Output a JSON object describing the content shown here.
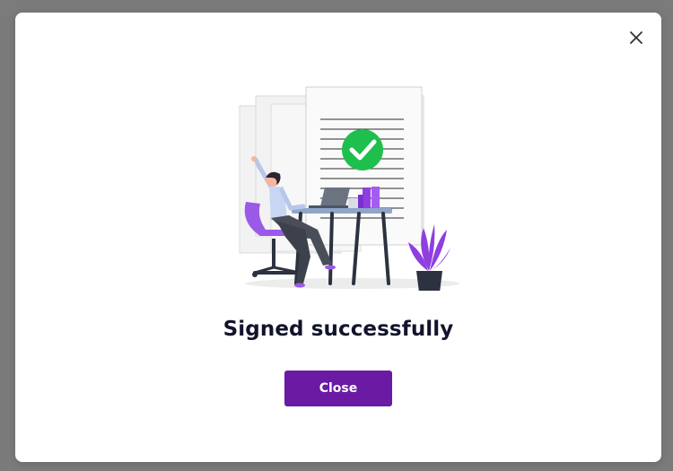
{
  "dialog": {
    "title": "Signed successfully",
    "close_button_label": "Close",
    "close_icon": "close-icon",
    "illustration": "woman-celebrating-at-desk-illustration"
  },
  "colors": {
    "backdrop": "#7b7b7b",
    "modal_bg": "#ffffff",
    "title_text": "#12142c",
    "primary_button_bg": "#6a1aa3",
    "primary_button_text": "#ffffff",
    "success_check": "#1fbf4e",
    "accent_purple": "#8f3fe0"
  }
}
